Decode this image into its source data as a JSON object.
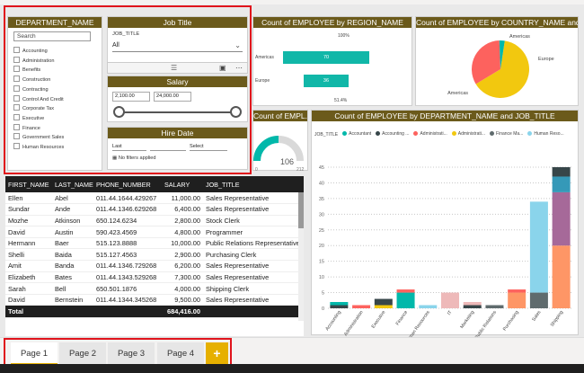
{
  "slicers": {
    "department": {
      "title": "DEPARTMENT_NAME",
      "search_placeholder": "Search",
      "items": [
        "Accounting",
        "Administration",
        "Benefits",
        "Construction",
        "Contracting",
        "Control And Credit",
        "Corporate Tax",
        "Executive",
        "Finance",
        "Government Sales",
        "Human Resources"
      ]
    },
    "job_title": {
      "title": "Job Title",
      "field": "JOB_TITLE",
      "selected": "All"
    },
    "salary": {
      "title": "Salary",
      "min": "2,100.00",
      "max": "24,000.00"
    },
    "hire_date": {
      "title": "Hire Date",
      "period": "Last",
      "unit": "Select",
      "no_filter": "No filters applied"
    }
  },
  "region_chart": {
    "title": "Count of EMPLOYEE by REGION_NAME",
    "top_pct": "100%",
    "bottom_pct": "51.4%",
    "chart_data": {
      "type": "bar",
      "categories": [
        "Americas",
        "Europe"
      ],
      "values": [
        70,
        36
      ]
    }
  },
  "country_chart": {
    "title": "Count of EMPLOYEE by COUNTRY_NAME and R...",
    "chart_data": {
      "type": "pie",
      "labels": [
        "Americas",
        "Europe",
        "Americas"
      ],
      "shares": [
        0.64,
        0.33,
        0.03
      ],
      "colors": [
        "#f2c80f",
        "#fd625e",
        "#01b8aa"
      ]
    }
  },
  "gauge": {
    "title": "Count of EMPL...",
    "value": "106",
    "min": "0",
    "max": "212",
    "chart_data": {
      "type": "gauge",
      "value": 106,
      "min": 0,
      "max": 212
    }
  },
  "job_chart": {
    "title": "Count of EMPLOYEE by DEPARTMENT_NAME and JOB_TITLE",
    "legend_field": "JOB_TITLE",
    "legend": [
      {
        "label": "Accountant",
        "color": "#01b8aa"
      },
      {
        "label": "Accounting ...",
        "color": "#374649"
      },
      {
        "label": "Administrati...",
        "color": "#fd625e"
      },
      {
        "label": "Administrati...",
        "color": "#f2c80f"
      },
      {
        "label": "Finance Ma...",
        "color": "#5f6b6d"
      },
      {
        "label": "Human Reso...",
        "color": "#8ad4eb"
      }
    ],
    "chart_data": {
      "type": "bar",
      "ylim": [
        0,
        45
      ],
      "yticks": [
        0,
        5,
        10,
        15,
        20,
        25,
        30,
        35,
        40,
        45
      ],
      "categories": [
        "Accounting",
        "Administration",
        "Executive",
        "Finance",
        "Human Resources",
        "IT",
        "Marketing",
        "Public Relations",
        "Purchasing",
        "Sales",
        "Shipping"
      ],
      "stacks": [
        [
          {
            "v": 1,
            "c": "#374649"
          },
          {
            "v": 1,
            "c": "#01b8aa"
          }
        ],
        [
          {
            "v": 1,
            "c": "#fd625e"
          }
        ],
        [
          {
            "v": 1,
            "c": "#f2c80f"
          },
          {
            "v": 2,
            "c": "#374649"
          }
        ],
        [
          {
            "v": 5,
            "c": "#01b8aa"
          },
          {
            "v": 1,
            "c": "#fd625e"
          }
        ],
        [
          {
            "v": 1,
            "c": "#8ad4eb"
          }
        ],
        [
          {
            "v": 5,
            "c": "#eeb9b9"
          }
        ],
        [
          {
            "v": 1,
            "c": "#374649"
          },
          {
            "v": 1,
            "c": "#eeb9b9"
          }
        ],
        [
          {
            "v": 1,
            "c": "#5f6b6d"
          }
        ],
        [
          {
            "v": 5,
            "c": "#fe9666"
          },
          {
            "v": 1,
            "c": "#fd625e"
          }
        ],
        [
          {
            "v": 5,
            "c": "#5f6b6d"
          },
          {
            "v": 29,
            "c": "#8ad4eb"
          }
        ],
        [
          {
            "v": 20,
            "c": "#fe9666"
          },
          {
            "v": 17,
            "c": "#a66999"
          },
          {
            "v": 5,
            "c": "#3599b8"
          },
          {
            "v": 3,
            "c": "#374649"
          }
        ]
      ]
    }
  },
  "table": {
    "columns": [
      "FIRST_NAME",
      "LAST_NAME",
      "PHONE_NUMBER",
      "SALARY",
      "JOB_TITLE"
    ],
    "rows": [
      [
        "Ellen",
        "Abel",
        "011.44.1644.429267",
        "11,000.00",
        "Sales Representative"
      ],
      [
        "Sundar",
        "Ande",
        "011.44.1346.629268",
        "6,400.00",
        "Sales Representative"
      ],
      [
        "Mozhe",
        "Atkinson",
        "650.124.6234",
        "2,800.00",
        "Stock Clerk"
      ],
      [
        "David",
        "Austin",
        "590.423.4569",
        "4,800.00",
        "Programmer"
      ],
      [
        "Hermann",
        "Baer",
        "515.123.8888",
        "10,000.00",
        "Public Relations Representative"
      ],
      [
        "Shelli",
        "Baida",
        "515.127.4563",
        "2,900.00",
        "Purchasing Clerk"
      ],
      [
        "Amit",
        "Banda",
        "011.44.1346.729268",
        "6,200.00",
        "Sales Representative"
      ],
      [
        "Elizabeth",
        "Bates",
        "011.44.1343.529268",
        "7,300.00",
        "Sales Representative"
      ],
      [
        "Sarah",
        "Bell",
        "650.501.1876",
        "4,000.00",
        "Shipping Clerk"
      ],
      [
        "David",
        "Bernstein",
        "011.44.1344.345268",
        "9,500.00",
        "Sales Representative"
      ]
    ],
    "total_label": "Total",
    "total_salary": "684,416.00"
  },
  "tabs": [
    "Page 1",
    "Page 2",
    "Page 3",
    "Page 4"
  ],
  "add_tab": "+"
}
